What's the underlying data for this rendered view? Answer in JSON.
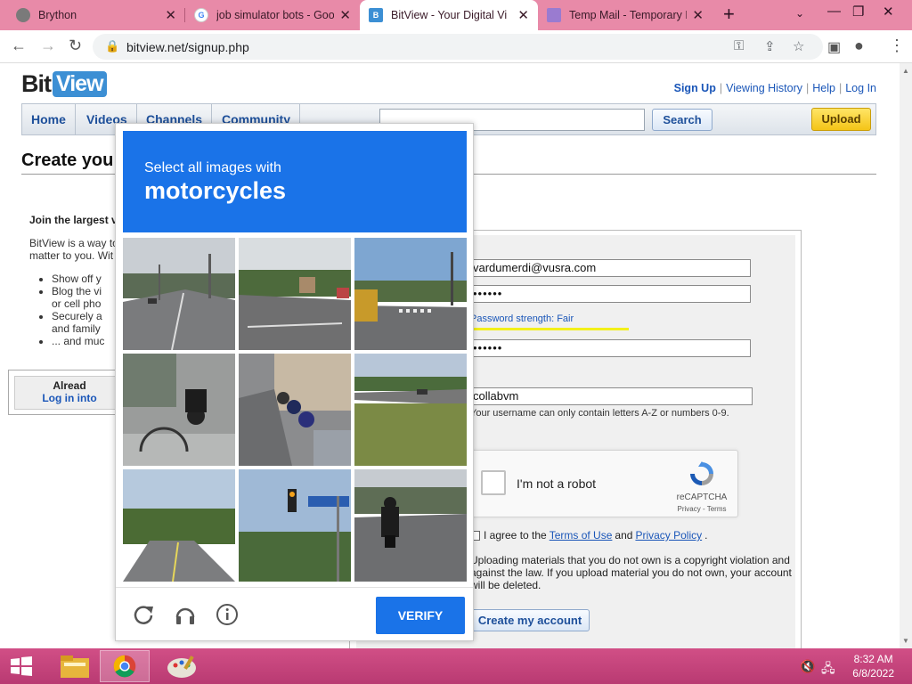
{
  "browser": {
    "tabs": [
      {
        "title": "Brython",
        "icon": "brython-favicon"
      },
      {
        "title": "job simulator bots - Goo",
        "icon": "google-favicon"
      },
      {
        "title": "BitView - Your Digital Vi",
        "icon": "bitview-favicon",
        "active": true
      },
      {
        "title": "Temp Mail - Temporary E",
        "icon": "tempmail-favicon"
      }
    ],
    "url": "bitview.net/signup.php"
  },
  "site": {
    "logo_bit": "Bit",
    "logo_view": "View",
    "top_links": {
      "signup": "Sign Up",
      "history": "Viewing History",
      "help": "Help",
      "login": "Log In"
    },
    "nav": [
      "Home",
      "Videos",
      "Channels",
      "Community"
    ],
    "search_label": "Search",
    "upload_label": "Upload"
  },
  "page": {
    "title": "Create you",
    "join_heading": "Join the largest v",
    "join_desc": "BitView is a way to matter to you. Wit",
    "join_bullets": [
      "Show off y",
      "Blog the vi",
      "or cell pho",
      "Securely a",
      "and family",
      "... and muc"
    ],
    "already_text": "Alread",
    "login_link": "Log in into",
    "account_heading": "nt"
  },
  "form": {
    "email": "vardumerdi@vusra.com",
    "password_mask": "••••••",
    "password_strength": "Password strength: Fair",
    "confirm_mask": "••••••",
    "username": "collabvm",
    "username_hint": "Your username can only contain letters A-Z or numbers 0-9.",
    "recaptcha": {
      "label": "I'm not a robot",
      "brand": "reCAPTCHA",
      "links": "Privacy - Terms"
    },
    "agree_prefix": "I agree to the",
    "terms_link": "Terms of Use",
    "agree_and": "and",
    "privacy_link": "Privacy Policy",
    "legal": "Uploading materials that you do not own is a copyright violation and against the law. If you upload material you do not own, your account will be deleted.",
    "create_button": "Create my account"
  },
  "captcha": {
    "prompt": "Select all images with",
    "target": "motorcycles",
    "verify": "VERIFY",
    "tiles": [
      "road-intersection",
      "road-intersection-2",
      "sidewalk-crossing",
      "parked-motorcycle",
      "parked-motorcycles-row",
      "field-roadside",
      "road-trees",
      "traffic-light-sign",
      "motorcycle-rider"
    ]
  },
  "taskbar": {
    "time": "8:32 AM",
    "date": "6/8/2022"
  }
}
